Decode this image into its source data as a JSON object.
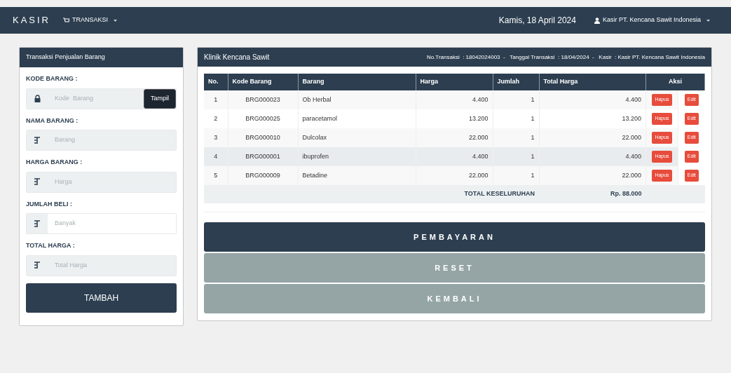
{
  "navbar": {
    "brand": "KASIR",
    "menu": "TRANSAKSI",
    "date": "Kamis, 18 April 2024",
    "user": "Kasir PT. Kencana Sawit Indonesia"
  },
  "form": {
    "title": "Transaksi Penjualan Barang",
    "fields": [
      {
        "label": "KODE BARANG :",
        "placeholder": "Kode  Barang",
        "kind": "lock",
        "readonly": true,
        "button": "Tampil"
      },
      {
        "label": "NAMA BARANG :",
        "placeholder": "Barang",
        "kind": "text",
        "readonly": true
      },
      {
        "label": "HARGA BARANG :",
        "placeholder": "Harga",
        "kind": "text",
        "readonly": true
      },
      {
        "label": "JUMLAH BELI :",
        "placeholder": "Banyak",
        "kind": "text",
        "readonly": false
      },
      {
        "label": "TOTAL HARGA :",
        "placeholder": "Total Harga",
        "kind": "text",
        "readonly": true
      }
    ],
    "submit": "TAMBAH"
  },
  "cart": {
    "title": "Klinik Kencana Sawit",
    "info": "No.Transaksi  : 18042024003  -   Tanggal Transaksi  : 18/04/2024  -   Kasir  : Kasir PT. Kencana Sawit Indonesia",
    "columns": [
      "No.",
      "Kode Barang",
      "Barang",
      "Harga",
      "Jumlah",
      "Total Harga",
      "Aksi"
    ],
    "rows": [
      {
        "no": "1",
        "code": "BRG000023",
        "name": "Ob Herbal",
        "price": "4.400",
        "qty": "1",
        "total": "4.400",
        "actions": [
          "Hapus",
          "Edit"
        ],
        "selected": false
      },
      {
        "no": "2",
        "code": "BRG000025",
        "name": "paracetamol",
        "price": "13.200",
        "qty": "1",
        "total": "13.200",
        "actions": [
          "Hapus",
          "Edit"
        ],
        "selected": false
      },
      {
        "no": "3",
        "code": "BRG000010",
        "name": "Dulcolax",
        "price": "22.000",
        "qty": "1",
        "total": "22.000",
        "actions": [
          "Hapus",
          "Edit"
        ],
        "selected": false
      },
      {
        "no": "4",
        "code": "BRG000001",
        "name": "ibuprofen",
        "price": "4.400",
        "qty": "1",
        "total": "4.400",
        "actions": [
          "Hapus",
          "Edit"
        ],
        "selected": true
      },
      {
        "no": "5",
        "code": "BRG000009",
        "name": "Betadine",
        "price": "22.000",
        "qty": "1",
        "total": "22.000",
        "actions": [
          "Hapus",
          "Edit"
        ],
        "selected": false
      }
    ],
    "total_label": "TOTAL KESELURUHAN",
    "total_value": "Rp. 88.000",
    "buttons": [
      {
        "label": "PEMBAYARAN",
        "kind": "primary"
      },
      {
        "label": "RESET",
        "kind": "secondary"
      },
      {
        "label": "KEMBALI",
        "kind": "secondary"
      }
    ]
  }
}
